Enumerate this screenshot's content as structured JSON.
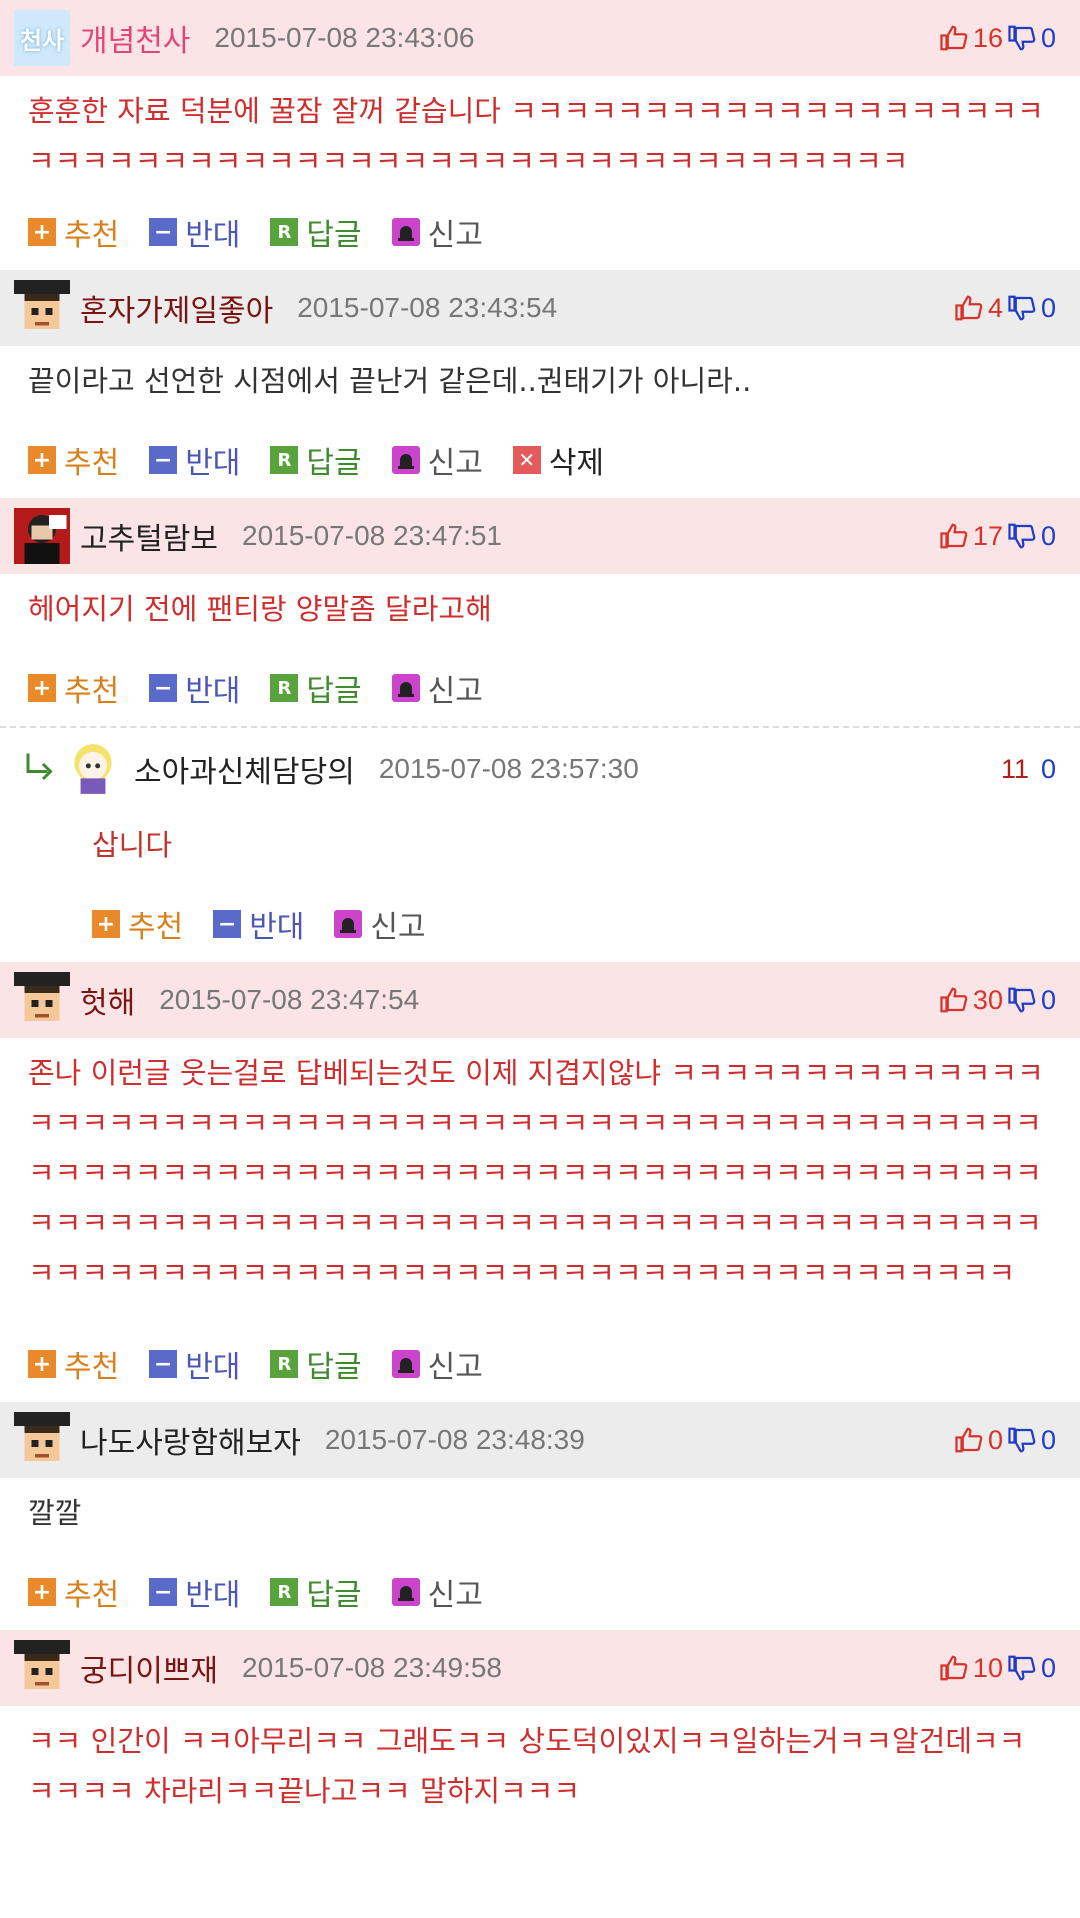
{
  "actions": {
    "recommend": "추천",
    "oppose": "반대",
    "reply": "답글",
    "report": "신고",
    "delete": "삭제",
    "reply_icon_letter": "R"
  },
  "comments": [
    {
      "nickname": "개념천사",
      "time": "2015-07-08 23:43:06",
      "up": "16",
      "down": "0",
      "avatar_text": "천사",
      "text": "훈훈한 자료 덕분에 꿀잠 잘꺼 같습니다 ㅋㅋㅋㅋㅋㅋㅋㅋㅋㅋㅋㅋㅋㅋㅋㅋㅋㅋㅋㅋㅋㅋㅋㅋㅋㅋㅋㅋㅋㅋㅋㅋㅋㅋㅋㅋㅋㅋㅋㅋㅋㅋㅋㅋㅋㅋㅋㅋㅋㅋㅋㅋㅋ"
    },
    {
      "nickname": "혼자가제일좋아",
      "time": "2015-07-08 23:43:54",
      "up": "4",
      "down": "0",
      "text": "끝이라고 선언한 시점에서 끝난거 같은데..권태기가 아니라.."
    },
    {
      "nickname": "고추털람보",
      "time": "2015-07-08 23:47:51",
      "up": "17",
      "down": "0",
      "text": "헤어지기 전에 팬티랑 양말좀 달라고해"
    },
    {
      "nickname": "소아과신체담당의",
      "time": "2015-07-08 23:57:30",
      "up": "11",
      "down": "0",
      "text": "삽니다"
    },
    {
      "nickname": "헛해",
      "time": "2015-07-08 23:47:54",
      "up": "30",
      "down": "0",
      "text": "존나 이런글 웃는걸로 답베되는것도 이제 지겹지않냐 ㅋㅋㅋㅋㅋㅋㅋㅋㅋㅋㅋㅋㅋㅋㅋㅋㅋㅋㅋㅋㅋㅋㅋㅋㅋㅋㅋㅋㅋㅋㅋㅋㅋㅋㅋㅋㅋㅋㅋㅋㅋㅋㅋㅋㅋㅋㅋㅋㅋㅋㅋㅋㅋㅋㅋㅋㅋㅋㅋㅋㅋㅋㅋㅋㅋㅋㅋㅋㅋㅋㅋㅋㅋㅋㅋㅋㅋㅋㅋㅋㅋㅋㅋㅋㅋㅋㅋㅋㅋㅋㅋㅋㅋㅋㅋㅋㅋㅋㅋㅋㅋㅋㅋㅋㅋㅋㅋㅋㅋㅋㅋㅋㅋㅋㅋㅋㅋㅋㅋㅋㅋㅋㅋㅋㅋㅋㅋㅋㅋㅋㅋㅋㅋㅋㅋㅋㅋㅋㅋㅋㅋㅋㅋㅋㅋㅋㅋㅋㅋㅋㅋㅋㅋㅋㅋㅋㅋㅋㅋㅋㅋㅋㅋㅋㅋ"
    },
    {
      "nickname": "나도사랑함해보자",
      "time": "2015-07-08 23:48:39",
      "up": "0",
      "down": "0",
      "text": "깔깔"
    },
    {
      "nickname": "궁디이쁘재",
      "time": "2015-07-08 23:49:58",
      "up": "10",
      "down": "0",
      "text": "ㅋㅋ 인간이 ㅋㅋ아무리ㅋㅋ 그래도ㅋㅋ 상도덕이있지ㅋㅋ일하는거ㅋㅋ알건데ㅋㅋㅋㅋㅋㅋ 차라리ㅋㅋ끝나고ㅋㅋ 말하지ㅋㅋㅋ"
    }
  ],
  "colors": {
    "header_pink": "#fbe4e6",
    "header_gray": "#ececec",
    "up_red": "#d9322a",
    "down_blue": "#1f3cc9",
    "text_red": "#cf2e2e"
  }
}
